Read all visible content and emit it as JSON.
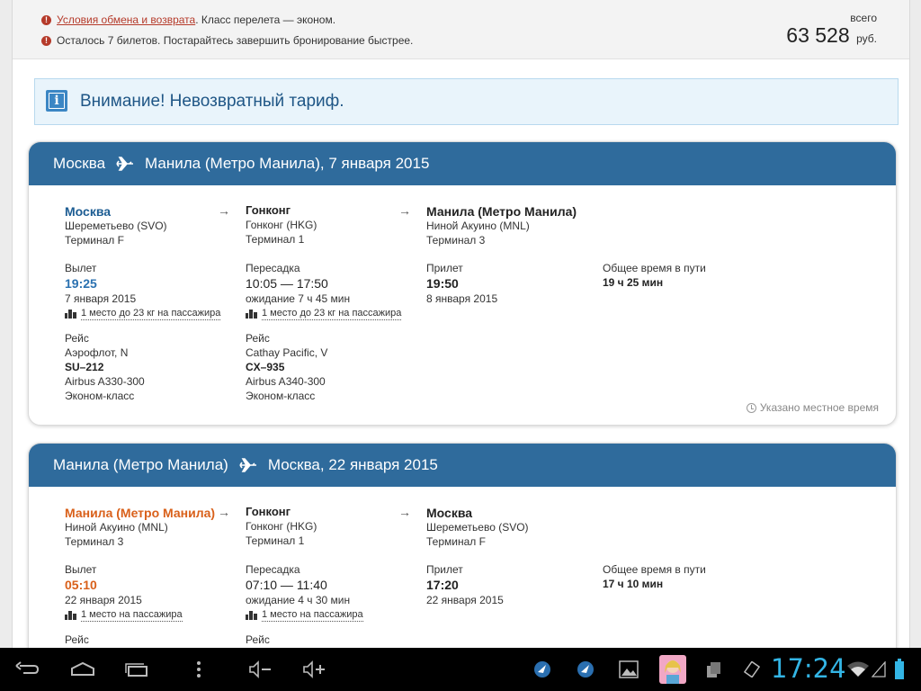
{
  "top": {
    "refund_link": "Условия обмена и возврата",
    "class_text": ". Класс перелета — эконом.",
    "tickets_left": "Осталось 7 билетов. Постарайтесь завершить бронирование быстрее.",
    "total_label": "всего",
    "total_amount": "63 528",
    "currency": "руб."
  },
  "notice": {
    "text": "Внимание! Невозвратный тариф."
  },
  "flights": [
    {
      "from": "Москва",
      "to_date": "Манила (Метро Манила), 7 января 2015",
      "origin": {
        "city": "Москва",
        "airport": "Шереметьево (SVO)",
        "terminal": "Терминал F"
      },
      "transfer": {
        "city": "Гонконг",
        "airport": "Гонконг (HKG)",
        "terminal": "Терминал 1"
      },
      "destination": {
        "city": "Манила (Метро Манила)",
        "airport": "Ниной Акуино (MNL)",
        "terminal": "Терминал 3"
      },
      "departure": {
        "label": "Вылет",
        "time": "19:25",
        "date": "7 января 2015",
        "baggage": "1 место до 23 кг на пассажира"
      },
      "layover": {
        "label": "Пересадка",
        "range": "10:05 — 17:50",
        "wait": "ожидание 7 ч 45 мин",
        "baggage": "1 место до 23 кг на пассажира"
      },
      "arrival": {
        "label": "Прилет",
        "time": "19:50",
        "date": "8 января 2015"
      },
      "duration": {
        "label": "Общее время в пути",
        "value": "19 ч 25 мин"
      },
      "leg1": {
        "label": "Рейс",
        "airline": "Аэрофлот, N",
        "number": "SU–212",
        "aircraft": "Airbus A330-300",
        "cabin": "Эконом-класс"
      },
      "leg2": {
        "label": "Рейс",
        "airline": "Cathay Pacific, V",
        "number": "CX–935",
        "aircraft": "Airbus A340-300",
        "cabin": "Эконом-класс"
      },
      "local_time_note": "Указано местное время"
    },
    {
      "from": "Манила (Метро Манила)",
      "to_date": "Москва, 22 января 2015",
      "origin": {
        "city": "Манила (Метро Манила)",
        "airport": "Ниной Акуино (MNL)",
        "terminal": "Терминал 3"
      },
      "transfer": {
        "city": "Гонконг",
        "airport": "Гонконг (HKG)",
        "terminal": "Терминал 1"
      },
      "destination": {
        "city": "Москва",
        "airport": "Шереметьево (SVO)",
        "terminal": "Терминал F"
      },
      "departure": {
        "label": "Вылет",
        "time": "05:10",
        "date": "22 января 2015",
        "baggage": "1 место на пассажира"
      },
      "layover": {
        "label": "Пересадка",
        "range": "07:10 — 11:40",
        "wait": "ожидание 4 ч 30 мин",
        "baggage": "1 место на пассажира"
      },
      "arrival": {
        "label": "Прилет",
        "time": "17:20",
        "date": "22 января 2015"
      },
      "duration": {
        "label": "Общее время в пути",
        "value": "17 ч 10 мин"
      },
      "leg1": {
        "label": "Рейс"
      },
      "leg2": {
        "label": "Рейс"
      }
    }
  ],
  "statusbar": {
    "time": "17:24"
  },
  "colors": {
    "header_blue": "#2f6b9c",
    "accent_orange": "#d9601a",
    "link_red": "#b53a2a",
    "clock_blue": "#33b5e5"
  }
}
